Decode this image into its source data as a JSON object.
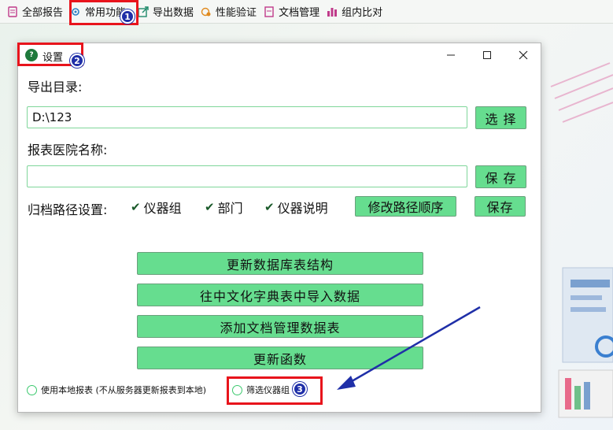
{
  "toolbar": {
    "items": [
      {
        "label": "全部报告",
        "icon": "report-icon"
      },
      {
        "label": "常用功能",
        "icon": "gear-cloud-icon"
      },
      {
        "label": "导出数据",
        "icon": "export-icon"
      },
      {
        "label": "性能验证",
        "icon": "performance-icon"
      },
      {
        "label": "文档管理",
        "icon": "document-icon"
      },
      {
        "label": "组内比对",
        "icon": "bar-chart-icon"
      }
    ]
  },
  "dialog": {
    "title": "设置",
    "logo_text": "?",
    "export_dir_label": "导出目录:",
    "export_dir_value": "D:\\123",
    "select_button": "选 择",
    "hospital_name_label": "报表医院名称:",
    "hospital_name_value": "",
    "save_button": "保 存",
    "archive_path_label": "归档路径设置:",
    "checkboxes": [
      {
        "label": "仪器组",
        "checked": true
      },
      {
        "label": "部门",
        "checked": true
      },
      {
        "label": "仪器说明",
        "checked": true
      }
    ],
    "modify_order_button": "修改路径顺序",
    "save_path_button": "保存",
    "action_buttons": [
      "更新数据库表结构",
      "往中文化字典表中导入数据",
      "添加文档管理数据表",
      "更新函数"
    ],
    "radio_local_report": "使用本地报表 (不从服务器更新报表到本地)",
    "radio_filter_instrument": "筛选仪器组"
  },
  "annotations": {
    "badges": [
      "1",
      "2",
      "3"
    ],
    "highlight_color": "#e8141c",
    "arrow_color": "#1f2fa8"
  },
  "colors": {
    "button_green": "#66dd8f",
    "field_border": "#7fd69a"
  }
}
